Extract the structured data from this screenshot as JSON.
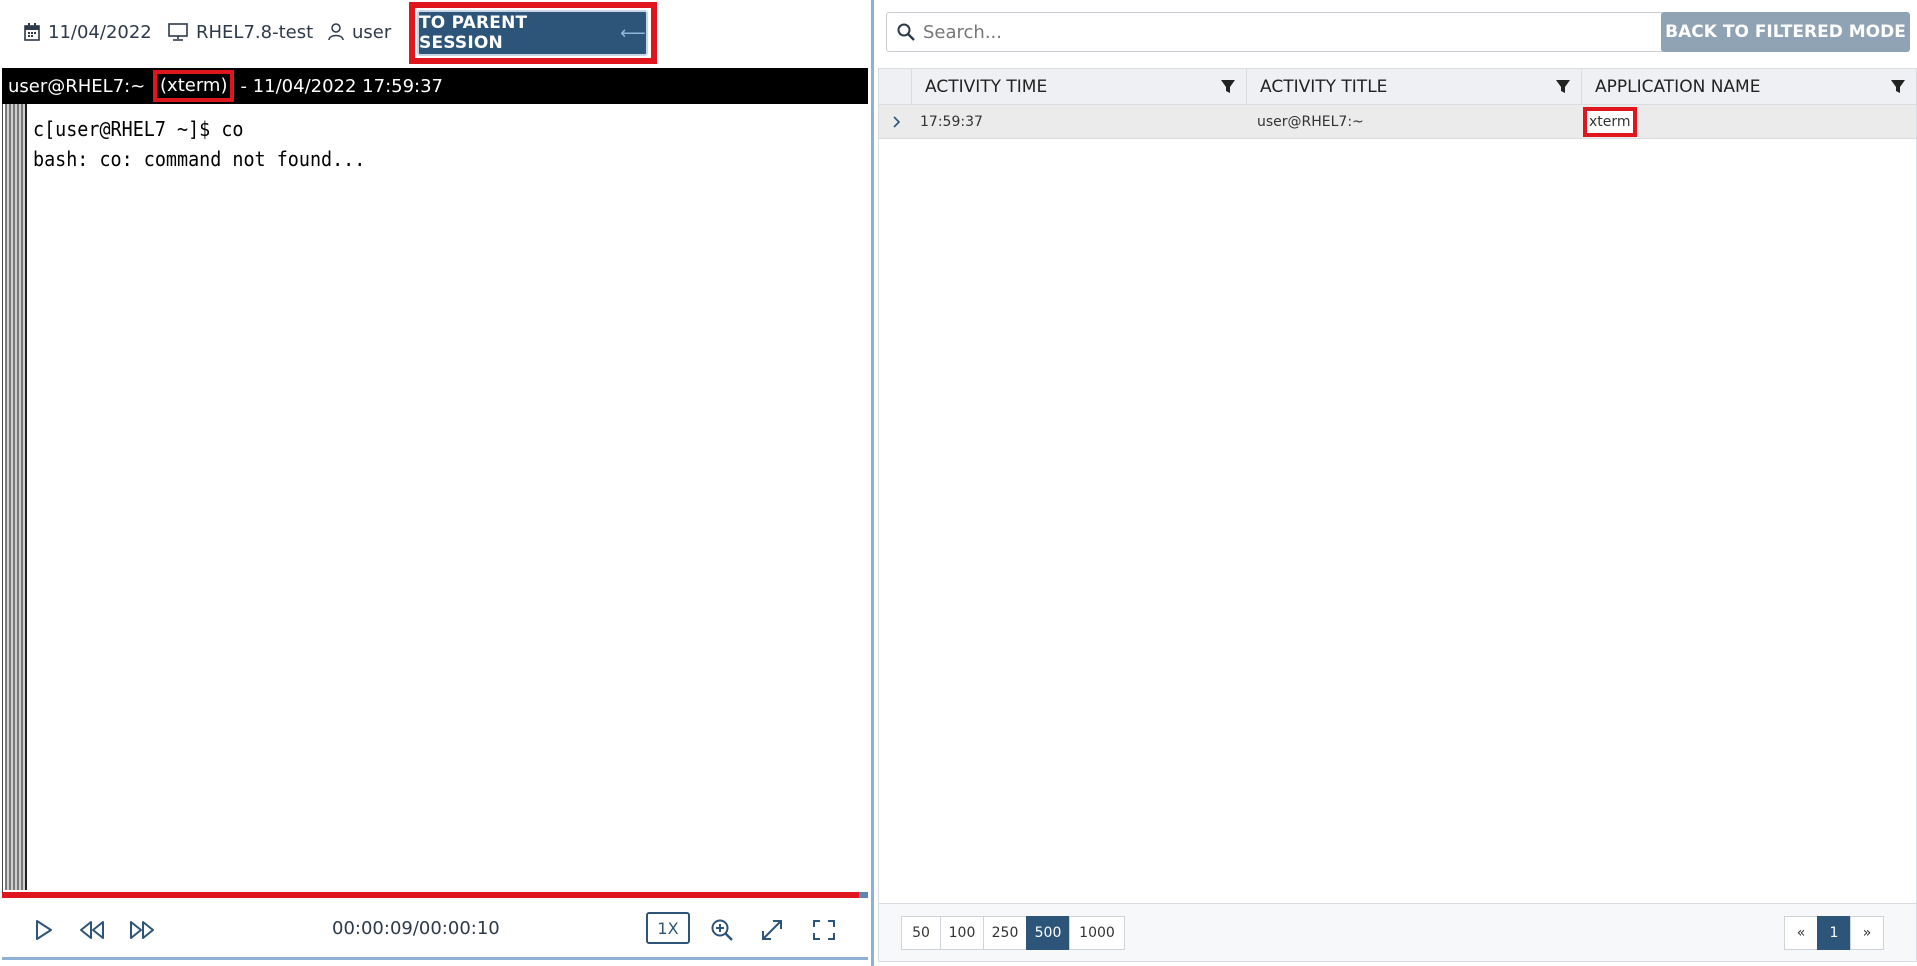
{
  "session": {
    "date": "11/04/2022",
    "host": "RHEL7.8-test",
    "user": "user",
    "parent_button": "TO PARENT SESSION",
    "parent_arrow": "⟵"
  },
  "terminal": {
    "title_prefix": "user@RHEL7:~ ",
    "title_app": "(xterm)",
    "title_suffix": "- 11/04/2022 17:59:37",
    "lines": [
      "c[user@RHEL7 ~]$ co",
      "bash: co: command not found..."
    ]
  },
  "player": {
    "time": "00:00:09/00:00:10",
    "speed": "1X",
    "progress_fraction": 0.99,
    "colors": {
      "played": "#e0161e",
      "remaining": "#5b87b8"
    }
  },
  "activities": {
    "search_placeholder": "Search...",
    "back_button": "BACK TO FILTERED MODE",
    "columns": [
      "ACTIVITY TIME",
      "ACTIVITY TITLE",
      "APPLICATION NAME"
    ],
    "rows": [
      {
        "time": "17:59:37",
        "title": "user@RHEL7:~",
        "app": "xterm"
      }
    ],
    "page_sizes": [
      "50",
      "100",
      "250",
      "500",
      "1000"
    ],
    "selected_page_size": "500",
    "pages": {
      "prev": "«",
      "current": "1",
      "next": "»"
    }
  },
  "icons": {
    "date": "calendar-icon",
    "host": "monitor-icon",
    "user": "user-icon",
    "play": "play-icon",
    "rewind": "rewind-icon",
    "forward": "fast-forward-icon",
    "zoom": "zoom-in-icon",
    "expand": "expand-icon",
    "fullscreen": "fullscreen-icon",
    "search": "search-icon",
    "filter": "filter-icon",
    "expand_row": "chevron-right-icon"
  },
  "colors": {
    "accent": "#2d5479",
    "highlight": "#e0161e"
  }
}
